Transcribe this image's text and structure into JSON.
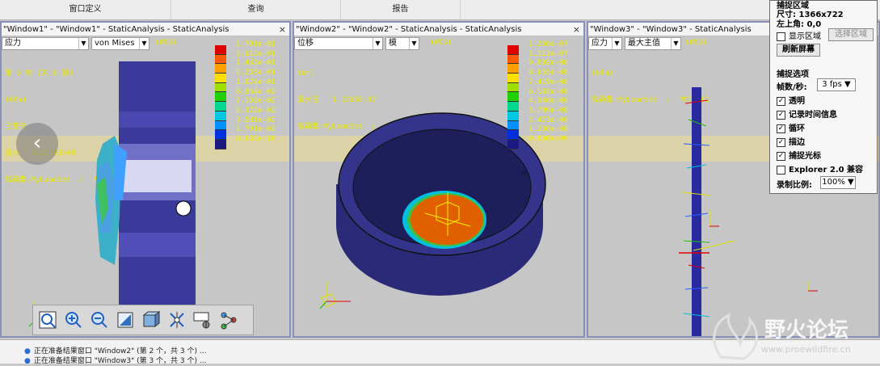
{
  "menubar": {
    "items": [
      "窗口定义",
      "查询",
      "报告"
    ]
  },
  "window1": {
    "title": "\"Window1\" - \"Window1\" - StaticAnalysis - StaticAnalysis",
    "close": "×",
    "select1": "应力",
    "select2": "von Mises",
    "wcs": "(WCS)",
    "info": [
      "第 5 帧 (共 8 帧)",
      "(kPa)",
      "已变形",
      "最大   3.2116E+08",
      "载荷集:MyLoadSet  :  PRT0001"
    ],
    "legend": [
      "1.791e-01",
      "1.612e-01",
      "1.433e-01",
      "1.253e-01",
      "1.074e-01",
      "8.954e-02",
      "7.163e-02",
      "5.372e-02",
      "3.581e-02",
      "1.791e-02",
      "8.632e-10"
    ]
  },
  "window2": {
    "title": "\"Window2\" - \"Window2\" - StaticAnalysis - StaticAnalysis",
    "close": "×",
    "select1": "位移",
    "select2": "模",
    "wcs": "(WCS)",
    "info": [
      "(mm)",
      "最大值   1.2365E-07",
      "载荷集:MyLoadSet  :  PRT0001"
    ],
    "legend": [
      "1.236e-07",
      "1.113e-07",
      "9.892e-08",
      "8.655e-08",
      "7.419e-08",
      "6.182e-08",
      "4.946e-08",
      "3.709e-08",
      "2.473e-08",
      "1.236e-08",
      "0.000e+00"
    ]
  },
  "window3": {
    "title": "\"Window3\" - \"Window3\" - StaticAnalysis",
    "select1": "应力",
    "select2": "最大主值",
    "wcs": "(WCS)",
    "info": [
      "(kPa)",
      "载荷集:MyLoadSet  :  PRT0001"
    ]
  },
  "legend_colors": [
    "#e00000",
    "#ff5a00",
    "#ffa000",
    "#ffe000",
    "#a0e000",
    "#20d000",
    "#00d890",
    "#00c8e0",
    "#0090ff",
    "#0030e0",
    "#1a1a80"
  ],
  "toolbar": {
    "icons": [
      "zoom-window-icon",
      "zoom-in-icon",
      "zoom-out-icon",
      "refit-icon",
      "orientation-icon",
      "spin-center-icon",
      "named-view-icon",
      "animation-icon"
    ]
  },
  "nav": {
    "prev": "‹",
    "next": "›"
  },
  "capture": {
    "section_region": "捕捉区域",
    "size": "尺寸: 1366x722",
    "top_left": "左上角: 0,0",
    "show_region": "显示区域",
    "select_region": "选择区域",
    "refresh": "刷新屏幕",
    "section_options": "捕捉选项",
    "fps_label": "帧数/秒:",
    "fps_value": "3 fps",
    "options": [
      {
        "label": "透明",
        "checked": true
      },
      {
        "label": "记录时间信息",
        "checked": true
      },
      {
        "label": "循环",
        "checked": true
      },
      {
        "label": "描边",
        "checked": true
      },
      {
        "label": "捕捉光标",
        "checked": true
      },
      {
        "label": "Explorer 2.0 兼容",
        "checked": false
      }
    ],
    "scale_label": "录制比例:",
    "scale_value": "100%"
  },
  "status": {
    "lines": [
      "正在准备结果窗口 \"Window2\" (第 2 个，共 3 个) ...",
      "正在准备结果窗口 \"Window3\" (第 3 个，共 3 个) ..."
    ]
  },
  "watermark": {
    "text": "野火论坛",
    "url": "www.proewildfire.cn"
  }
}
